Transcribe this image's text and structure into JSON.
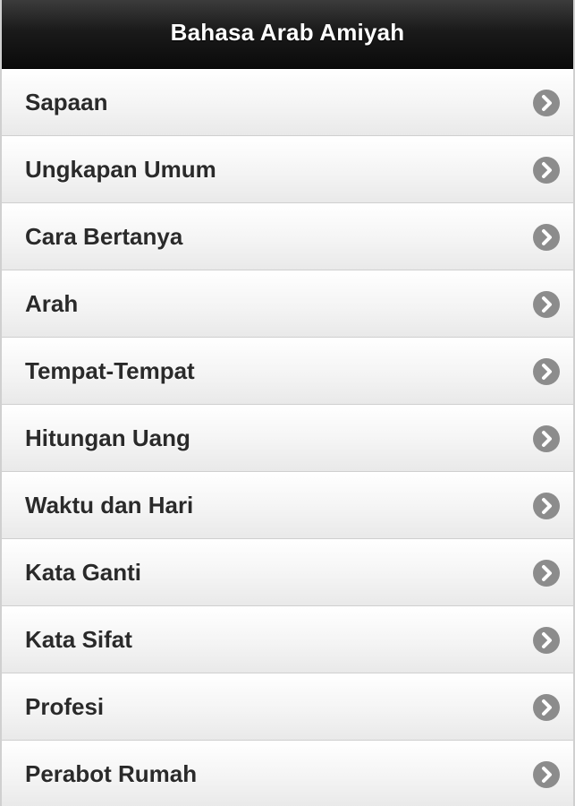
{
  "header": {
    "title": "Bahasa Arab Amiyah"
  },
  "menu": {
    "items": [
      {
        "label": "Sapaan",
        "icon": "chevron-right-icon"
      },
      {
        "label": "Ungkapan Umum",
        "icon": "chevron-right-icon"
      },
      {
        "label": "Cara Bertanya",
        "icon": "chevron-right-icon"
      },
      {
        "label": "Arah",
        "icon": "chevron-right-icon"
      },
      {
        "label": "Tempat-Tempat",
        "icon": "chevron-right-icon"
      },
      {
        "label": "Hitungan Uang",
        "icon": "chevron-right-icon"
      },
      {
        "label": "Waktu dan Hari",
        "icon": "chevron-right-icon"
      },
      {
        "label": "Kata Ganti",
        "icon": "chevron-right-icon"
      },
      {
        "label": "Kata Sifat",
        "icon": "chevron-right-icon"
      },
      {
        "label": "Profesi",
        "icon": "chevron-right-icon"
      },
      {
        "label": "Perabot Rumah",
        "icon": "chevron-right-icon"
      }
    ]
  },
  "colors": {
    "header_bg": "#111111",
    "header_text": "#ffffff",
    "item_text": "#2a2a2a",
    "chevron_bg": "#8c8c8c",
    "chevron_fg": "#ffffff"
  }
}
